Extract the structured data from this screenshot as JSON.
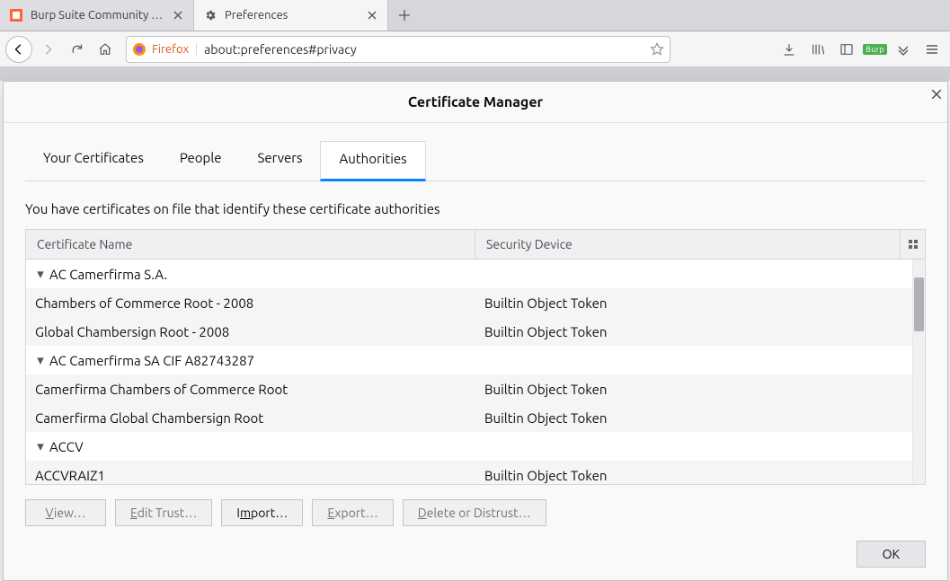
{
  "browser_tabs": [
    {
      "title": "Burp Suite Community E…",
      "active": false,
      "favicon": "burp"
    },
    {
      "title": "Preferences",
      "active": true,
      "favicon": "gear"
    }
  ],
  "urlbar": {
    "identity_label": "Firefox",
    "url": "about:preferences#privacy"
  },
  "right_badge": "Burp",
  "dialog": {
    "title": "Certificate Manager",
    "tabs": [
      "Your Certificates",
      "People",
      "Servers",
      "Authorities"
    ],
    "active_tab": "Authorities",
    "description": "You have certificates on file that identify these certificate authorities",
    "columns": {
      "name": "Certificate Name",
      "device": "Security Device"
    },
    "tree": [
      {
        "type": "parent",
        "name": "AC Camerfirma S.A."
      },
      {
        "type": "child",
        "name": "Chambers of Commerce Root - 2008",
        "device": "Builtin Object Token"
      },
      {
        "type": "child",
        "name": "Global Chambersign Root - 2008",
        "device": "Builtin Object Token"
      },
      {
        "type": "parent",
        "name": "AC Camerfirma SA CIF A82743287"
      },
      {
        "type": "child",
        "name": "Camerfirma Chambers of Commerce Root",
        "device": "Builtin Object Token"
      },
      {
        "type": "child",
        "name": "Camerfirma Global Chambersign Root",
        "device": "Builtin Object Token"
      },
      {
        "type": "parent",
        "name": "ACCV"
      },
      {
        "type": "child",
        "name": "ACCVRAIZ1",
        "device": "Builtin Object Token"
      }
    ],
    "buttons": {
      "view": {
        "label_pre": "V",
        "label_post": "iew…",
        "enabled": false
      },
      "edit": {
        "label_pre": "E",
        "label_post": "dit Trust…",
        "enabled": false
      },
      "import": {
        "label_pre": "I",
        "label_mid": "m",
        "label_post": "port…",
        "enabled": true
      },
      "export": {
        "label_pre": "E",
        "label_post": "xport…",
        "enabled": false
      },
      "delete": {
        "label_pre": "D",
        "label_post": "elete or Distrust…",
        "enabled": false
      }
    },
    "ok_label": "OK"
  }
}
